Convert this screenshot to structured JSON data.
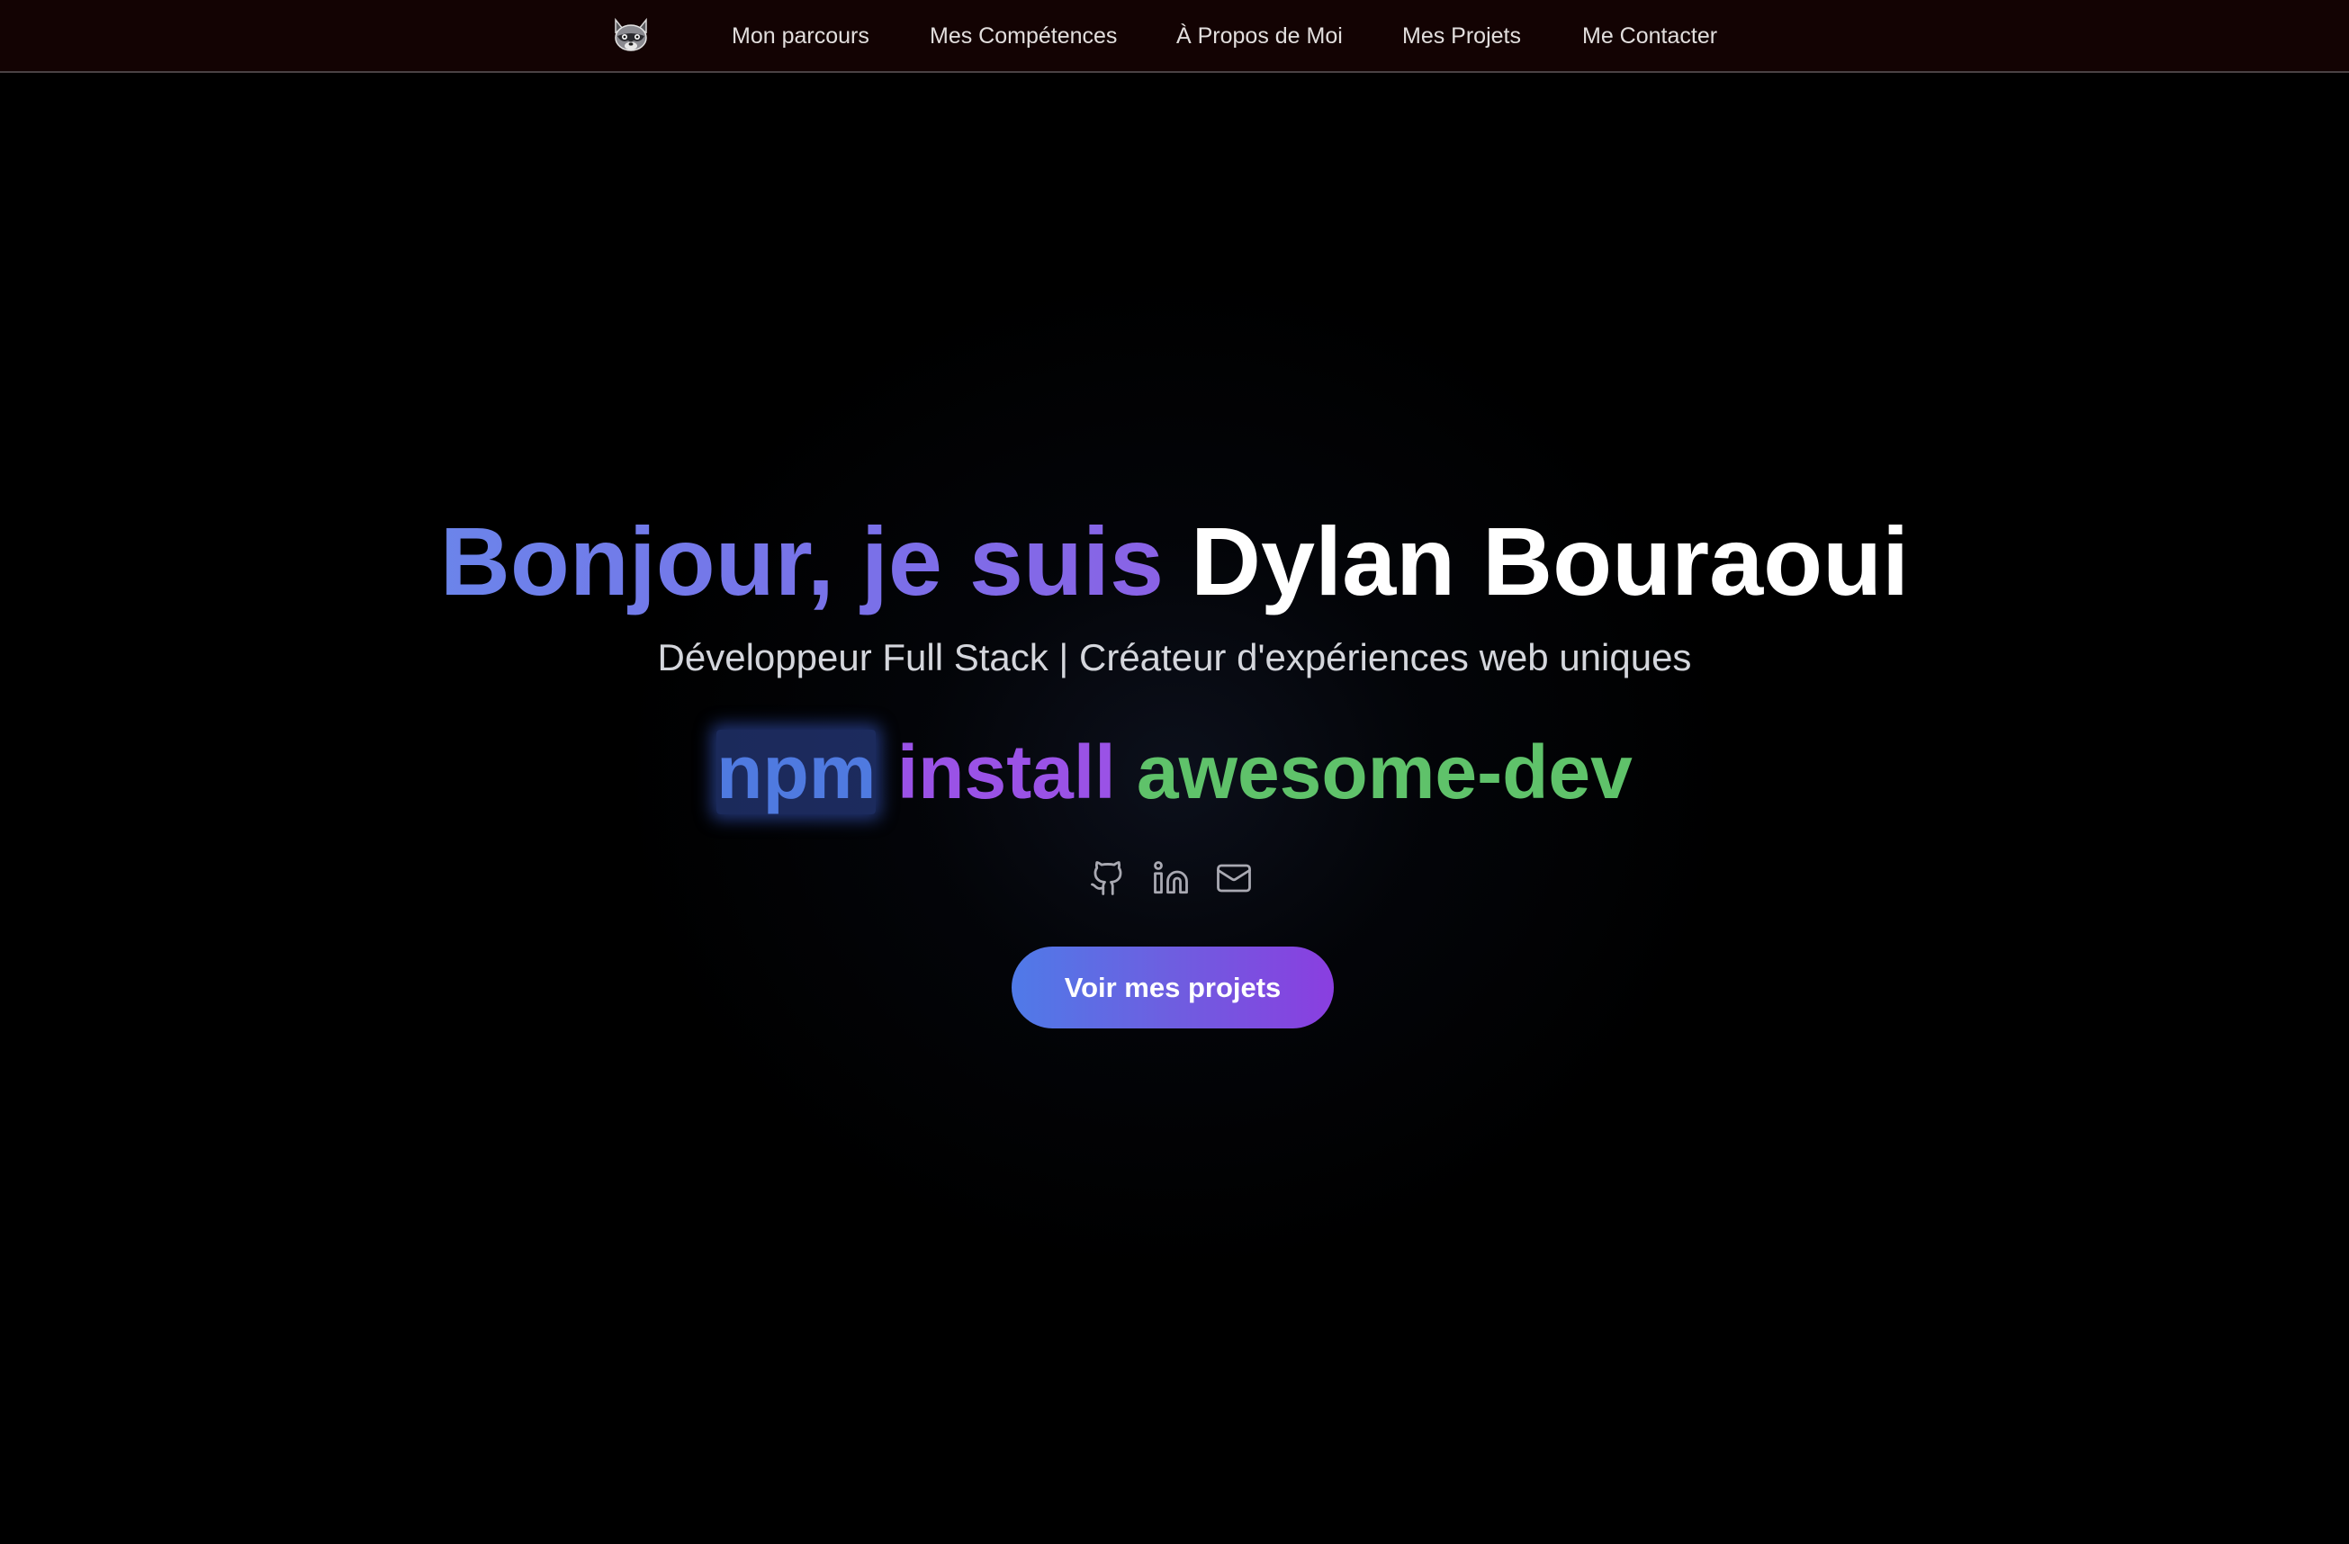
{
  "nav": {
    "logo_icon": "raccoon-icon",
    "items": [
      {
        "label": "Mon parcours"
      },
      {
        "label": "Mes Compétences"
      },
      {
        "label": "À Propos de Moi"
      },
      {
        "label": "Mes Projets"
      },
      {
        "label": "Me Contacter"
      }
    ]
  },
  "hero": {
    "greeting": "Bonjour, je suis",
    "name": "Dylan Bouraoui",
    "subtitle": "Développeur Full Stack | Créateur d'expériences web uniques",
    "command": {
      "tool": "npm",
      "action": "install",
      "package": "awesome-dev"
    },
    "socials": [
      {
        "icon": "github-icon"
      },
      {
        "icon": "linkedin-icon"
      },
      {
        "icon": "mail-icon"
      }
    ],
    "cta_label": "Voir mes projets"
  },
  "colors": {
    "nav_background": "#130303",
    "greeting_gradient": [
      "#6b84ea",
      "#8a62e6"
    ],
    "npm": "#4f7ae0",
    "install": "#9a52e6",
    "package": "#5fc26a",
    "cta_gradient": [
      "#4f7ae8",
      "#8a3ee0"
    ]
  }
}
